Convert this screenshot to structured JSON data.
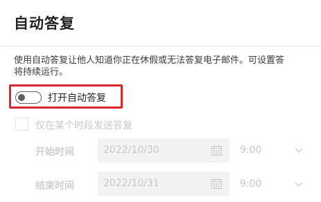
{
  "page": {
    "title": "自动答复",
    "description_line1": "使用自动答复让他人知道你正在休假或无法答复电子邮件。可设置答",
    "description_line2": "将持续运行。"
  },
  "auto_reply_toggle": {
    "label": "打开自动答复",
    "state": "off"
  },
  "time_period_checkbox": {
    "label": "仅在某个时段发送答复",
    "checked": false
  },
  "schedule": {
    "start": {
      "label": "开始时间",
      "date": "2022/10/30",
      "time": "9:00"
    },
    "end": {
      "label": "结束时间",
      "date": "2022/10/31",
      "time": "9:00"
    }
  },
  "colors": {
    "highlight_border": "#d9242a",
    "disabled_text": "#c6c6c6",
    "field_background": "#f3f3f3"
  },
  "icons": {
    "calendar": "calendar-icon",
    "dropdown": "chevron-down-icon"
  }
}
